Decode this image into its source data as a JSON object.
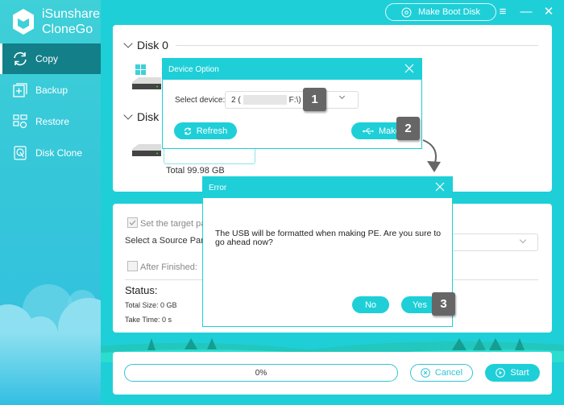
{
  "app": {
    "name_line1": "iSunshare",
    "name_line2": "CloneGo"
  },
  "sidebar": {
    "items": [
      {
        "label": "Copy",
        "icon": "refresh-cycle-icon",
        "active": true
      },
      {
        "label": "Backup",
        "icon": "backup-plus-icon",
        "active": false
      },
      {
        "label": "Restore",
        "icon": "restore-grid-icon",
        "active": false
      },
      {
        "label": "Disk Clone",
        "icon": "disk-clone-icon",
        "active": false
      }
    ]
  },
  "topbar": {
    "make_boot_disk": "Make Boot Disk",
    "menu_icon": "≡",
    "minimize_icon": "—",
    "close_icon": "✕"
  },
  "disks": {
    "disk0": "Disk 0",
    "disk1": "Disk",
    "disk1_total": "Total 99.98 GB"
  },
  "options": {
    "set_target": "Set the target pa",
    "select_source": "Select a Source Par",
    "after_finished": "After Finished:",
    "status_label": "Status:",
    "total_size": "Total Size: 0 GB",
    "take_time": "Take Time: 0 s"
  },
  "footer": {
    "progress_text": "0%",
    "progress_value": 0,
    "cancel": "Cancel",
    "start": "Start"
  },
  "device_dialog": {
    "title": "Device Option",
    "select_label": "Select device:",
    "device_value_prefix": "2 (",
    "device_value_suffix": "F:\\)",
    "refresh": "Refresh",
    "make": "Make"
  },
  "error_dialog": {
    "title": "Error",
    "message": "The USB will be formatted when making PE. Are you sure to go ahead now?",
    "no": "No",
    "yes": "Yes"
  },
  "step_badges": [
    "1",
    "2",
    "3"
  ],
  "colors": {
    "accent": "#1ecfd8",
    "active_nav": "#137f89",
    "badge": "#666666"
  }
}
